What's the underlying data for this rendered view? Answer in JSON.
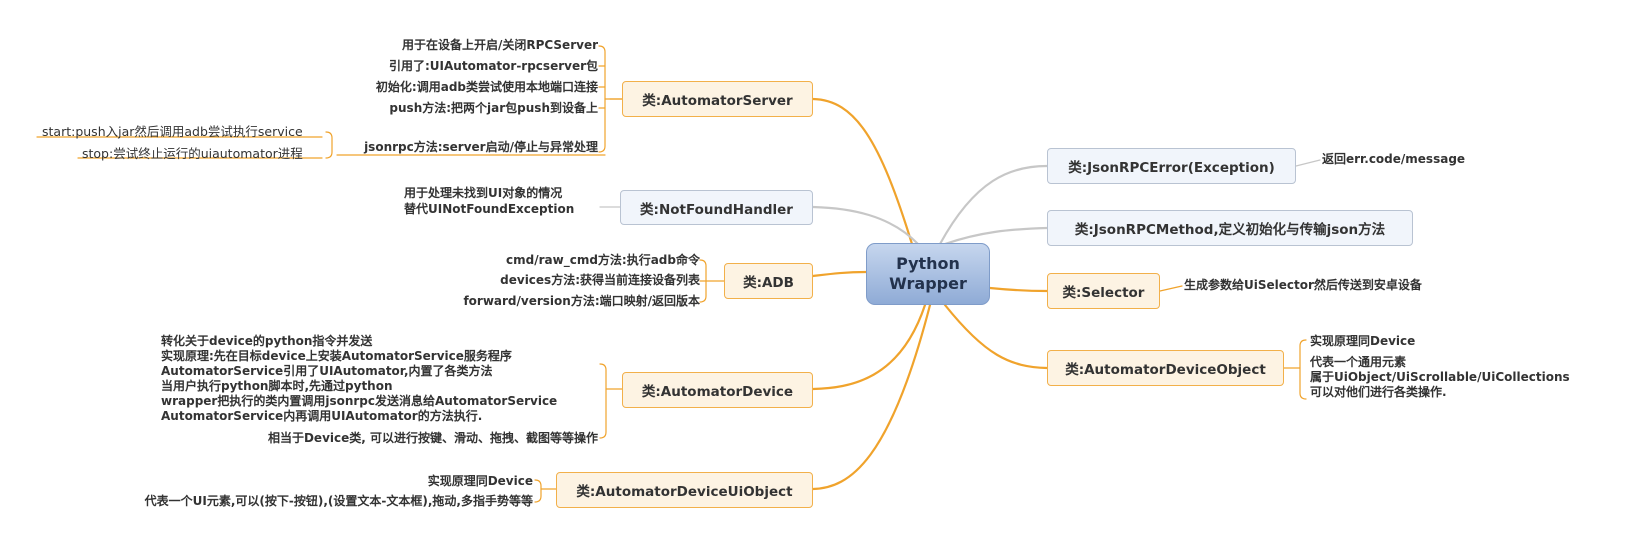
{
  "root": {
    "line1": "Python",
    "line2": "Wrapper"
  },
  "automator_server": {
    "label": "类:AutomatorServer",
    "items": [
      "用于在设备上开启/关闭RPCServer",
      "引用了:UIAutomator-rpcserver包",
      "初始化:调用adb类尝试使用本地端口连接",
      "push方法:把两个jar包push到设备上",
      "jsonrpc方法:server启动/停止与异常处理"
    ],
    "sub_items": [
      "start:push入jar然后调用adb尝试执行service",
      "stop:尝试终止运行的uiautomator进程"
    ]
  },
  "not_found_handler": {
    "label": "类:NotFoundHandler",
    "desc": [
      "用于处理未找到UI对象的情况",
      "替代UINotFoundException"
    ]
  },
  "adb": {
    "label": "类:ADB",
    "items": [
      "cmd/raw_cmd方法:执行adb命令",
      "devices方法:获得当前连接设备列表",
      "forward/version方法:端口映射/返回版本"
    ]
  },
  "automator_device": {
    "label": "类:AutomatorDevice",
    "desc": [
      "转化关于device的python指令并发送",
      "实现原理:先在目标device上安装AutomatorService服务程序",
      "AutomatorService引用了UIAutomator,内置了各类方法",
      "当用户执行python脚本时,先通过python",
      "wrapper把执行的类内置调用jsonrpc发送消息给AutomatorService",
      "AutomatorService内再调用UIAutomator的方法执行."
    ],
    "item2": "相当于Device类, 可以进行按键、滑动、拖拽、截图等等操作"
  },
  "automator_device_uiobject": {
    "label": "类:AutomatorDeviceUiObject",
    "items": [
      "实现原理同Device",
      "代表一个UI元素,可以(按下-按钮),(设置文本-文本框),拖动,多指手势等等"
    ]
  },
  "jsonrpc_error": {
    "label": "类:JsonRPCError(Exception)",
    "item": "返回err.code/message"
  },
  "jsonrpc_method": {
    "label": "类:JsonRPCMethod,定义初始化与传输json方法"
  },
  "selector": {
    "label": "类:Selector",
    "item": "生成参数给UiSelector然后传送到安卓设备"
  },
  "automator_device_object": {
    "label": "类:AutomatorDeviceObject",
    "item1": "实现原理同Device",
    "item2": [
      "代表一个通用元素",
      "属于UiObject/UiScrollable/UiCollections",
      "可以对他们进行各类操作."
    ]
  },
  "colors": {
    "orange": "#f0a32c",
    "gray": "#c7c7c7",
    "root": "#9bb4dc"
  }
}
